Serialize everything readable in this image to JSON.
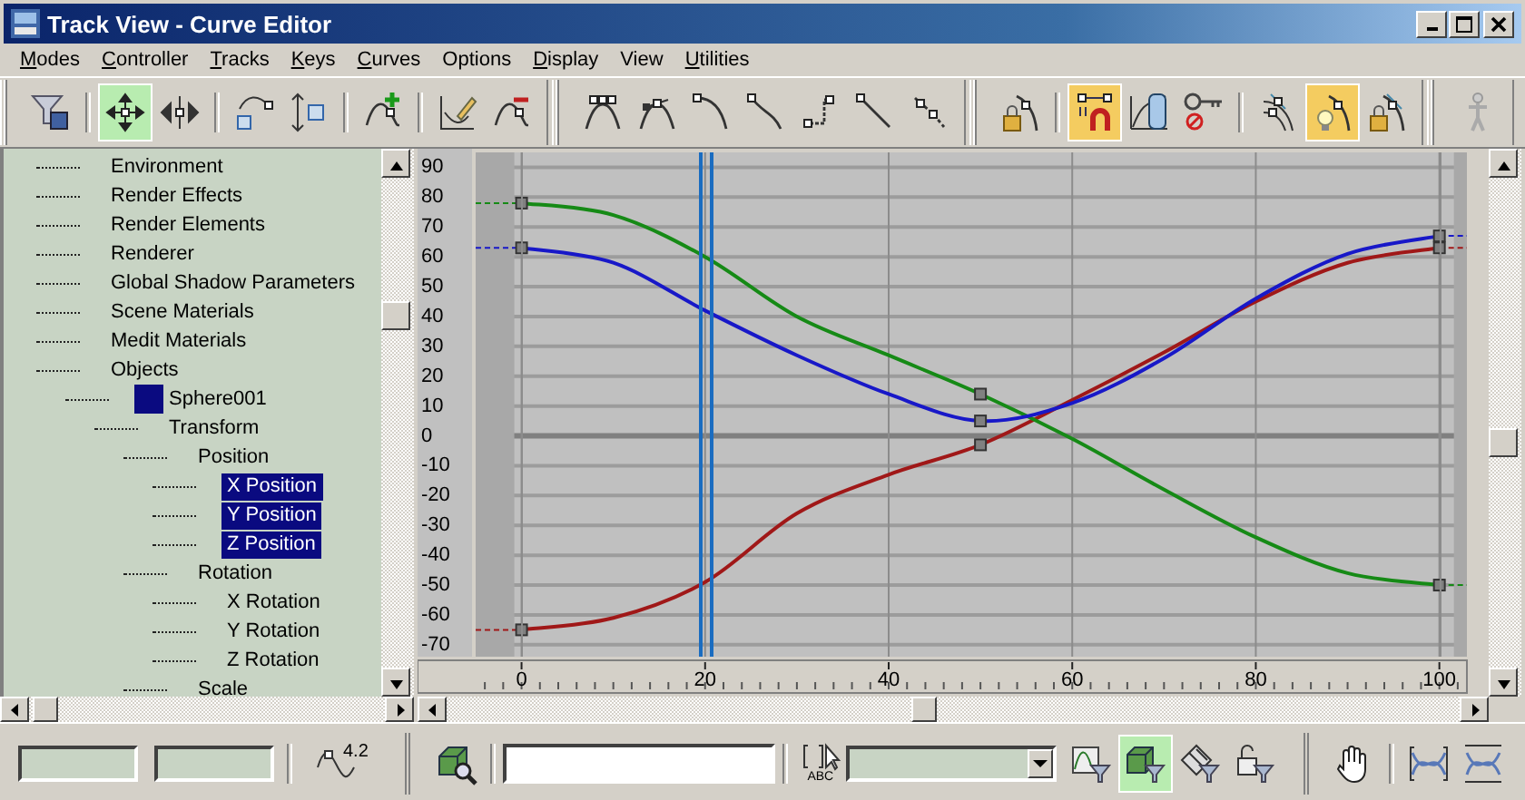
{
  "window": {
    "title": "Track View - Curve Editor"
  },
  "menu": [
    {
      "label": "Modes",
      "mnemonic": true
    },
    {
      "label": "Controller",
      "mnemonic": true
    },
    {
      "label": "Tracks",
      "mnemonic": true
    },
    {
      "label": "Keys",
      "mnemonic": true
    },
    {
      "label": "Curves",
      "mnemonic": true
    },
    {
      "label": "Options",
      "mnemonic": false
    },
    {
      "label": "Display",
      "mnemonic": true
    },
    {
      "label": "View",
      "mnemonic": false
    },
    {
      "label": "Utilities",
      "mnemonic": true
    }
  ],
  "toolbar": {
    "groups": [
      [
        {
          "kind": "filter",
          "selected": false
        },
        {
          "kind": "sep"
        },
        {
          "kind": "move-keys",
          "selected": true
        },
        {
          "kind": "slide-keys",
          "selected": false
        },
        {
          "kind": "sep"
        },
        {
          "kind": "scale-keys",
          "selected": false
        },
        {
          "kind": "scale-values",
          "selected": false
        },
        {
          "kind": "sep"
        },
        {
          "kind": "add-keys",
          "selected": false
        },
        {
          "kind": "sep"
        },
        {
          "kind": "draw-curves",
          "selected": false
        },
        {
          "kind": "reduce-keys",
          "selected": false
        }
      ],
      [
        {
          "kind": "tangent-auto",
          "selected": false
        },
        {
          "kind": "tangent-custom",
          "selected": false
        },
        {
          "kind": "tangent-fast",
          "selected": false
        },
        {
          "kind": "tangent-slow",
          "selected": false
        },
        {
          "kind": "tangent-step",
          "selected": false
        },
        {
          "kind": "tangent-linear",
          "selected": false
        },
        {
          "kind": "tangent-smooth",
          "selected": false
        }
      ],
      [
        {
          "kind": "lock-selection",
          "selected": false
        },
        {
          "kind": "sep"
        },
        {
          "kind": "snap-frames",
          "selected": true
        },
        {
          "kind": "parameter-range",
          "selected": false
        },
        {
          "kind": "show-keyable",
          "selected": false
        },
        {
          "kind": "sep"
        },
        {
          "kind": "show-all-tangents",
          "selected": false
        },
        {
          "kind": "show-tangents",
          "selected": true
        },
        {
          "kind": "lock-tangents",
          "selected": false
        }
      ],
      [
        {
          "kind": "figure",
          "selected": false
        }
      ]
    ]
  },
  "tree": [
    {
      "label": "Environment",
      "selected": false
    },
    {
      "label": "Render Effects",
      "selected": false
    },
    {
      "label": "Render Elements",
      "selected": false
    },
    {
      "label": "Renderer",
      "selected": false
    },
    {
      "label": "Global Shadow Parameters",
      "selected": false
    },
    {
      "label": "Scene Materials",
      "selected": false
    },
    {
      "label": "Medit Materials",
      "selected": false
    },
    {
      "label": "Objects",
      "selected": false,
      "children": [
        {
          "label": "Sphere001",
          "selected": false,
          "color": "#0a0a80",
          "children": [
            {
              "label": "Transform",
              "selected": false,
              "children": [
                {
                  "label": "Position",
                  "selected": false,
                  "children": [
                    {
                      "label": "X Position",
                      "selected": true
                    },
                    {
                      "label": "Y Position",
                      "selected": true
                    },
                    {
                      "label": "Z Position",
                      "selected": true
                    }
                  ]
                },
                {
                  "label": "Rotation",
                  "selected": false,
                  "children": [
                    {
                      "label": "X Rotation",
                      "selected": false
                    },
                    {
                      "label": "Y Rotation",
                      "selected": false
                    },
                    {
                      "label": "Z Rotation",
                      "selected": false
                    }
                  ]
                },
                {
                  "label": "Scale",
                  "selected": false
                }
              ]
            }
          ]
        }
      ]
    }
  ],
  "curve_view": {
    "time_slider": {
      "level": 0.2
    },
    "chart_data": {
      "type": "line",
      "grid": true,
      "x": [
        0,
        10,
        20,
        30,
        40,
        50,
        60,
        70,
        80,
        90,
        100
      ],
      "series": [
        {
          "color": "#a01818",
          "values": [
            -65,
            -61,
            -49,
            -26,
            -13,
            -3,
            12,
            28,
            45,
            58,
            63
          ]
        },
        {
          "color": "#168a16",
          "values": [
            78,
            74,
            60,
            40,
            27,
            14,
            -1,
            -18,
            -34,
            -46,
            -50
          ]
        },
        {
          "color": "#1818c8",
          "values": [
            63,
            58,
            42,
            27,
            14,
            5,
            11,
            26,
            46,
            61,
            67
          ]
        }
      ],
      "xlim": [
        -5,
        103
      ],
      "ylim": [
        -74,
        95
      ],
      "xticks": [
        0,
        20,
        40,
        60,
        80,
        100
      ],
      "yticks": [
        -70,
        -60,
        -50,
        -40,
        -30,
        -20,
        -10,
        0,
        10,
        20,
        30,
        40,
        50,
        60,
        70,
        80,
        90
      ]
    }
  },
  "bottom_toolbar": {
    "items": [
      {
        "kind": "field"
      },
      {
        "kind": "field"
      },
      {
        "kind": "sep"
      },
      {
        "kind": "key-value",
        "label": "4.2"
      },
      {
        "kind": "grip"
      },
      {
        "kind": "zoom-selected"
      },
      {
        "kind": "sep"
      },
      {
        "kind": "name-field"
      },
      {
        "kind": "sep"
      },
      {
        "kind": "select-by-name",
        "label": "ABC"
      },
      {
        "kind": "dropdown"
      },
      {
        "kind": "filter-curve",
        "selected": false
      },
      {
        "kind": "filter-object",
        "selected": true
      },
      {
        "kind": "filter-animated",
        "selected": false
      },
      {
        "kind": "filter-unlocked",
        "selected": false
      },
      {
        "kind": "grip"
      },
      {
        "kind": "pan",
        "selected": false
      },
      {
        "kind": "sep"
      },
      {
        "kind": "zoom-horizontal",
        "selected": false
      },
      {
        "kind": "zoom-value",
        "selected": false
      }
    ]
  }
}
